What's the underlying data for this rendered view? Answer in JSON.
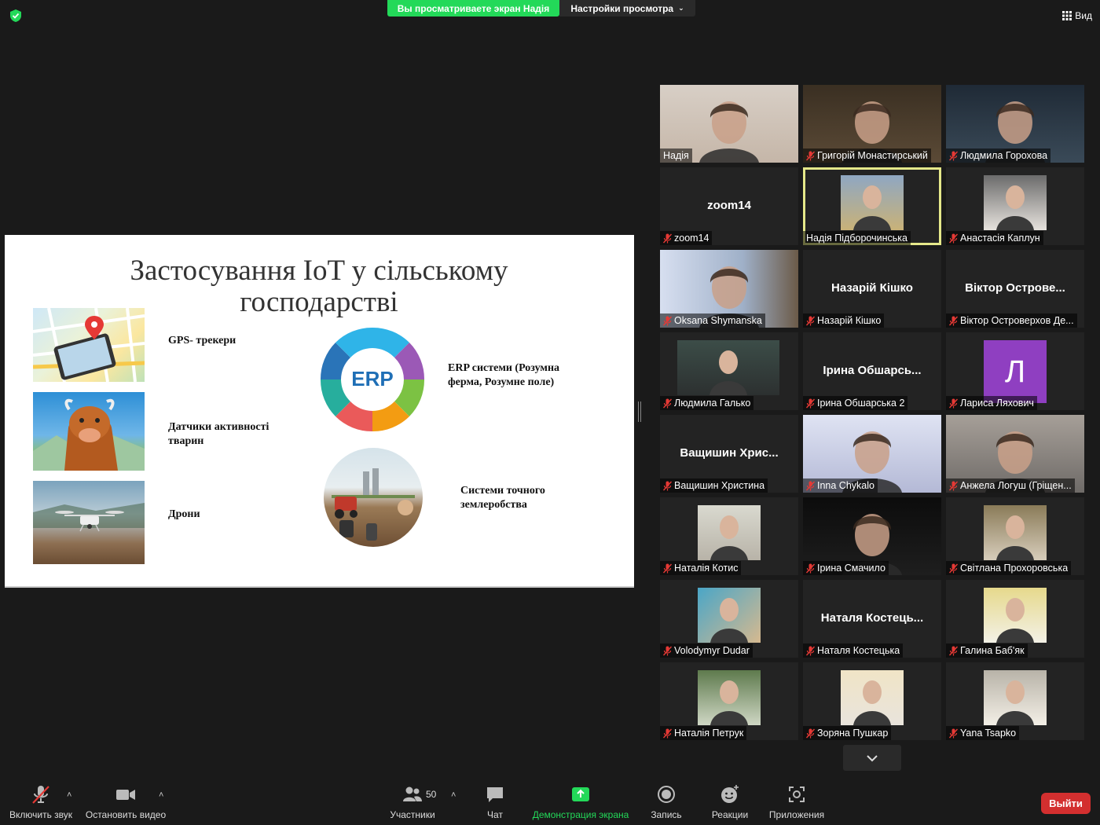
{
  "top": {
    "share_banner": "Вы просматриваете экран Надія",
    "view_settings": "Настройки просмотра",
    "view_button": "Вид"
  },
  "slide": {
    "title": "Застосування IoT у сільському господарстві",
    "gps_label": "GPS- трекери",
    "animal_label": "Датчики активності тварин",
    "drone_label": "Дрони",
    "erp_label": "ERP системи (Розумна ферма, Розумне поле)",
    "erp_center": "ERP",
    "precision_label": "Системи точного землеробства"
  },
  "gallery": [
    {
      "name": "Надія",
      "muted": false,
      "bigname": ""
    },
    {
      "name": "Григорій Монастирський",
      "muted": true,
      "bigname": ""
    },
    {
      "name": "Людмила Горохова",
      "muted": true,
      "bigname": ""
    },
    {
      "name": "zoom14",
      "muted": true,
      "bigname": "zoom14"
    },
    {
      "name": "Надія Підборочинська",
      "muted": false,
      "bigname": ""
    },
    {
      "name": "Анастасія Каплун",
      "muted": true,
      "bigname": ""
    },
    {
      "name": "Oksana Shymanska",
      "muted": true,
      "bigname": ""
    },
    {
      "name": "Назарій Кішко",
      "muted": true,
      "bigname": "Назарій Кішко"
    },
    {
      "name": "Віктор Островерхов Де...",
      "muted": true,
      "bigname": "Віктор  Острове..."
    },
    {
      "name": "Людмила Галько",
      "muted": true,
      "bigname": ""
    },
    {
      "name": "Ірина Обшарська 2",
      "muted": true,
      "bigname": "Ірина  Обшарсь..."
    },
    {
      "name": "Лариса Ляхович",
      "muted": true,
      "bigname": "",
      "letter": "Л"
    },
    {
      "name": "Ващишин Христина",
      "muted": true,
      "bigname": "Ващишин  Хрис..."
    },
    {
      "name": "Inna Chykalo",
      "muted": true,
      "bigname": ""
    },
    {
      "name": "Анжела Логуш (Гріщен...",
      "muted": true,
      "bigname": ""
    },
    {
      "name": "Наталія Котис",
      "muted": true,
      "bigname": ""
    },
    {
      "name": "Ірина Смачило",
      "muted": true,
      "bigname": ""
    },
    {
      "name": "Світлана Прохоровська",
      "muted": true,
      "bigname": ""
    },
    {
      "name": "Volodymyr Dudar",
      "muted": true,
      "bigname": ""
    },
    {
      "name": "Наталя Костецька",
      "muted": true,
      "bigname": "Наталя  Костець..."
    },
    {
      "name": "Галина Баб'як",
      "muted": true,
      "bigname": ""
    },
    {
      "name": "Наталія Петрук",
      "muted": true,
      "bigname": ""
    },
    {
      "name": "Зоряна Пушкар",
      "muted": true,
      "bigname": ""
    },
    {
      "name": "Yana Tsapko",
      "muted": true,
      "bigname": ""
    }
  ],
  "toolbar": {
    "unmute": "Включить звук",
    "stop_video": "Остановить видео",
    "participants": "Участники",
    "participants_count": "50",
    "chat": "Чат",
    "share": "Демонстрация экрана",
    "record": "Запись",
    "reactions": "Реакции",
    "apps": "Приложения",
    "leave": "Выйти"
  },
  "colors": {
    "share_green": "#23d959",
    "leave_red": "#d32f2f",
    "active_speaker": "#e5e88a",
    "avatar_purple": "#8f3fc1"
  }
}
